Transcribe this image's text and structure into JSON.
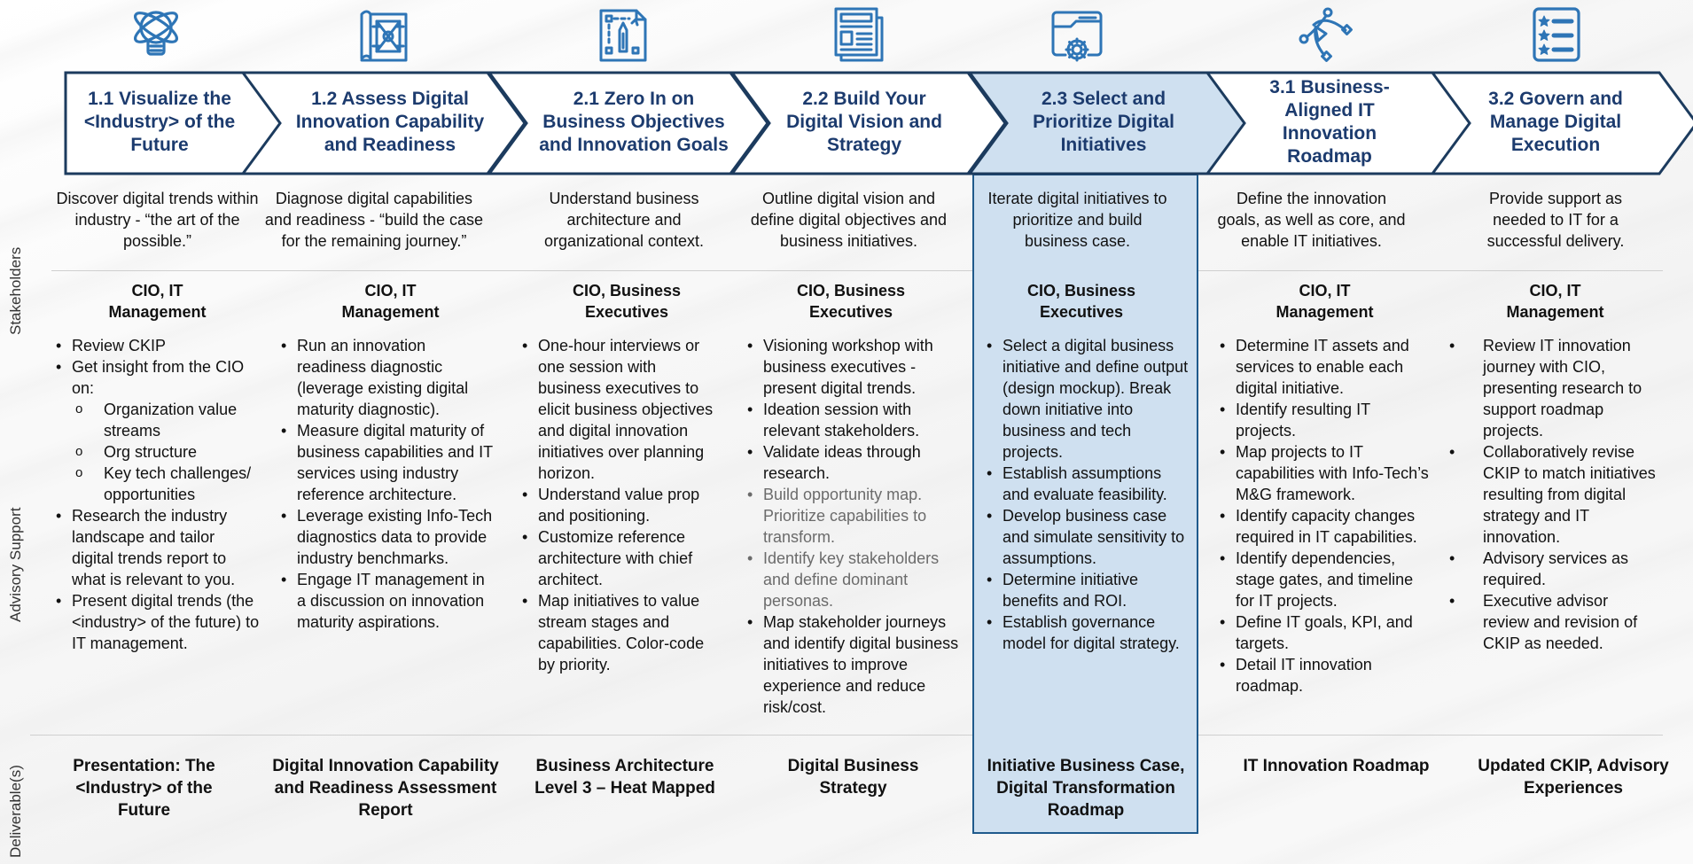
{
  "row_labels": {
    "stakeholders": "Stakeholders",
    "advisory": "Advisory Support",
    "deliverables": "Deliverable(s)"
  },
  "colors": {
    "accent_dark": "#1c3b6e",
    "chevron_border": "#1c3b5e",
    "icon_blue": "#2e75b6",
    "highlight_fill": "#cfe0f0",
    "highlight_border": "#1f5a8c"
  },
  "phases": [
    {
      "icon": "lightbulb-globe-icon",
      "title": "1.1 Visualize the <Industry> of the Future",
      "description": "Discover digital trends within industry - “the art of the possible.”",
      "stakeholders": "CIO, IT Management",
      "advisory": [
        {
          "text": "Review CKIP"
        },
        {
          "text": "Get insight from the CIO on:"
        },
        {
          "text": "Organization value streams",
          "sub": true
        },
        {
          "text": "Org structure",
          "sub": true
        },
        {
          "text": "Key tech challenges/ opportunities",
          "sub": true
        },
        {
          "text": "Research the industry landscape and tailor digital trends report to what is relevant to you."
        },
        {
          "text": "Present digital trends (the <industry> of the future) to IT management."
        }
      ],
      "deliverable": "Presentation: The <Industry> of the Future"
    },
    {
      "icon": "blueprint-icon",
      "title": "1.2 Assess Digital Innovation Capability and Readiness",
      "description": "Diagnose digital capabilities and readiness - “build the case for the remaining journey.”",
      "stakeholders": "CIO, IT Management",
      "advisory": [
        {
          "text": "Run an innovation readiness diagnostic (leverage existing digital maturity diagnostic)."
        },
        {
          "text": "Measure digital maturity of business capabilities and IT services using industry reference architecture."
        },
        {
          "text": "Leverage existing Info-Tech diagnostics data to provide industry benchmarks."
        },
        {
          "text": "Engage IT management in a discussion on innovation maturity aspirations."
        }
      ],
      "deliverable": "Digital Innovation Capability and Readiness Assessment Report"
    },
    {
      "icon": "design-pencil-icon",
      "title": "2.1 Zero In on Business Objectives and Innovation Goals",
      "description": "Understand business architecture and organizational context.",
      "stakeholders": "CIO, Business Executives",
      "advisory": [
        {
          "text": "One-hour interviews or one session with business executives to elicit business objectives and digital innovation initiatives over planning horizon."
        },
        {
          "text": "Understand value prop and positioning."
        },
        {
          "text": "Customize reference architecture with chief architect."
        },
        {
          "text": "Map initiatives to value stream stages and capabilities. Color-code by priority."
        }
      ],
      "deliverable": "Business Architecture Level 3 – Heat Mapped"
    },
    {
      "icon": "document-icon",
      "title": "2.2 Build Your Digital Vision and Strategy",
      "description": "Outline digital vision and define digital objectives and business initiatives.",
      "stakeholders": "CIO, Business Executives",
      "advisory": [
        {
          "text": "Visioning workshop with business executives - present digital trends."
        },
        {
          "text": "Ideation session with relevant stakeholders."
        },
        {
          "text": "Validate ideas through research."
        },
        {
          "text": "Build opportunity map. Prioritize capabilities to transform.",
          "gray": true
        },
        {
          "text": "Identify key stakeholders and define dominant personas.",
          "gray": true
        },
        {
          "text": "Map stakeholder journeys and identify digital business initiatives to improve experience and reduce risk/cost."
        }
      ],
      "deliverable": "Digital Business Strategy"
    },
    {
      "icon": "browser-gear-icon",
      "title": "2.3 Select and Prioritize Digital Initiatives",
      "description": "Iterate digital initiatives to prioritize and build business case.",
      "stakeholders": "CIO, Business Executives",
      "advisory": [
        {
          "text": "Select a digital business initiative and define output (design mockup). Break down initiative into business and tech projects."
        },
        {
          "text": "Establish assumptions and evaluate feasibility."
        },
        {
          "text": "Develop business case and simulate sensitivity to assumptions."
        },
        {
          "text": "Determine initiative benefits and ROI."
        },
        {
          "text": "Establish governance model for digital strategy."
        }
      ],
      "deliverable": "Initiative Business Case, Digital Transformation Roadmap",
      "highlighted": true
    },
    {
      "icon": "vector-path-icon",
      "title": "3.1 Business-Aligned IT Innovation Roadmap",
      "description": "Define the innovation goals, as well as core, and enable IT initiatives.",
      "stakeholders": "CIO, IT Management",
      "advisory": [
        {
          "text": "Determine IT assets and services to enable each digital initiative."
        },
        {
          "text": "Identify resulting IT projects."
        },
        {
          "text": "Map projects to IT capabilities with Info-Tech’s M&G framework."
        },
        {
          "text": "Identify capacity changes required in IT capabilities."
        },
        {
          "text": "Identify dependencies, stage gates, and timeline for IT projects."
        },
        {
          "text": "Define IT goals, KPI, and targets."
        },
        {
          "text": "Detail IT innovation roadmap."
        }
      ],
      "deliverable": "IT Innovation Roadmap"
    },
    {
      "icon": "star-checklist-icon",
      "title": "3.2 Govern and Manage Digital Execution",
      "description": "Provide support as needed to IT for a successful delivery.",
      "stakeholders": "CIO, IT Management",
      "advisory": [
        {
          "text": "Review IT innovation journey with CIO, presenting research to support roadmap projects."
        },
        {
          "text": "Collaboratively revise CKIP to match initiatives resulting from digital strategy and IT innovation."
        },
        {
          "text": "Advisory services as required."
        },
        {
          "text": "Executive advisor review and revision of CKIP as needed."
        }
      ],
      "deliverable": "Updated CKIP, Advisory Experiences"
    }
  ]
}
